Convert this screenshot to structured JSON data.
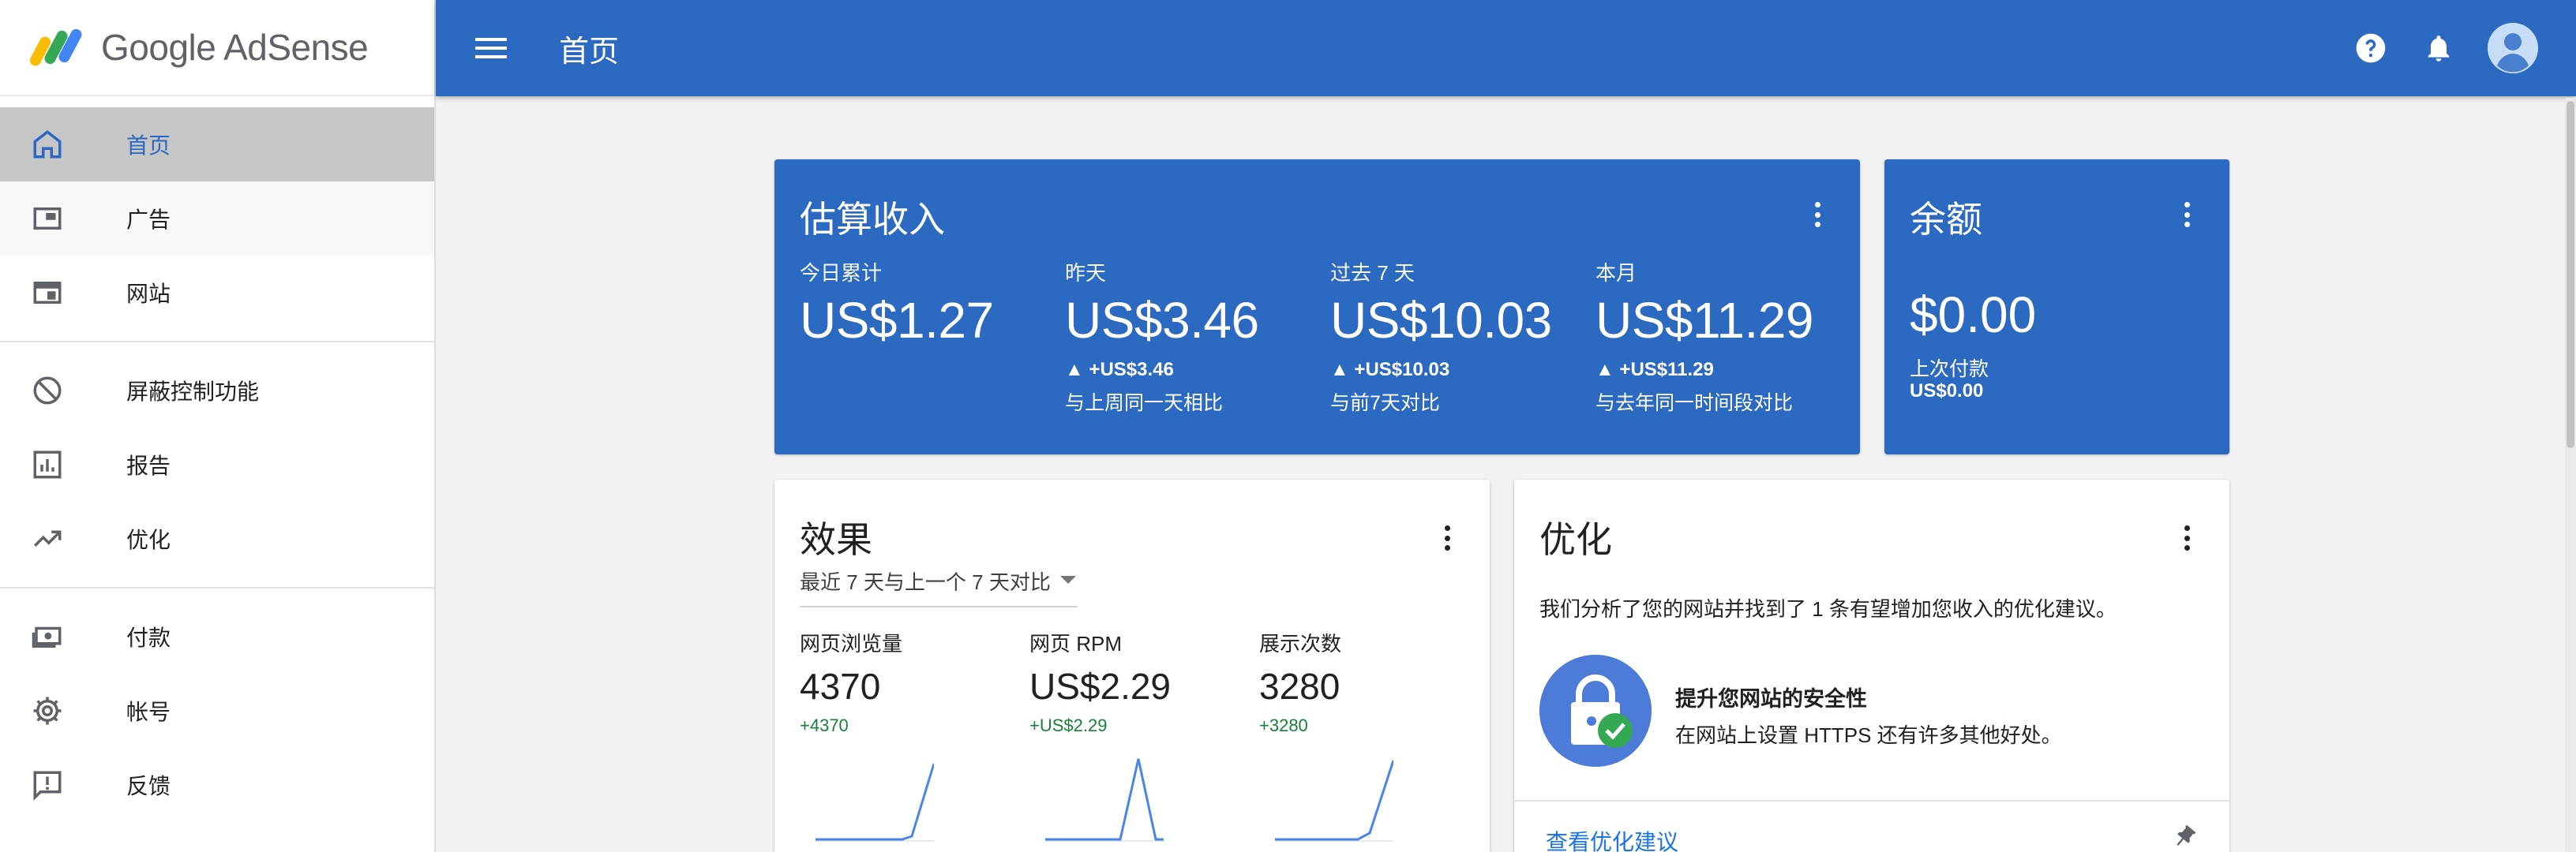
{
  "app": {
    "name": "Google AdSense"
  },
  "header": {
    "title": "首页"
  },
  "sidebar": {
    "items": [
      {
        "label": "首页",
        "icon": "home-icon"
      },
      {
        "label": "广告",
        "icon": "ads-icon"
      },
      {
        "label": "网站",
        "icon": "sites-icon"
      },
      {
        "label": "屏蔽控制功能",
        "icon": "block-icon"
      },
      {
        "label": "报告",
        "icon": "reports-icon"
      },
      {
        "label": "优化",
        "icon": "trending-icon"
      },
      {
        "label": "付款",
        "icon": "payments-icon"
      },
      {
        "label": "帐号",
        "icon": "gear-icon"
      },
      {
        "label": "反馈",
        "icon": "feedback-icon"
      }
    ]
  },
  "earnings": {
    "title": "估算收入",
    "stats": [
      {
        "label": "今日累计",
        "value": "US$1.27",
        "delta": "",
        "compare": ""
      },
      {
        "label": "昨天",
        "value": "US$3.46",
        "delta": "▲ +US$3.46",
        "compare": "与上周同一天相比"
      },
      {
        "label": "过去 7 天",
        "value": "US$10.03",
        "delta": "▲ +US$10.03",
        "compare": "与前7天对比"
      },
      {
        "label": "本月",
        "value": "US$11.29",
        "delta": "▲ +US$11.29",
        "compare": "与去年同一时间段对比"
      }
    ]
  },
  "balance": {
    "title": "余额",
    "value": "$0.00",
    "last_payment_label": "上次付款",
    "last_payment_value": "US$0.00"
  },
  "performance": {
    "title": "效果",
    "range": "最近 7 天与上一个 7 天对比",
    "stats": [
      {
        "label": "网页浏览量",
        "value": "4370",
        "delta": "+4370"
      },
      {
        "label": "网页 RPM",
        "value": "US$2.29",
        "delta": "+US$2.29"
      },
      {
        "label": "展示次数",
        "value": "3280",
        "delta": "+3280"
      }
    ]
  },
  "optimization": {
    "title": "优化",
    "description": "我们分析了您的网站并找到了 1 条有望增加您收入的优化建议。",
    "item_title": "提升您网站的安全性",
    "item_subtitle": "在网站上设置 HTTPS 还有许多其他好处。",
    "link": "查看优化建议"
  },
  "colors": {
    "primary": "#2c69c1",
    "active_nav_bg": "#c6c6c6",
    "positive": "#188038",
    "link": "#1a73e8"
  }
}
